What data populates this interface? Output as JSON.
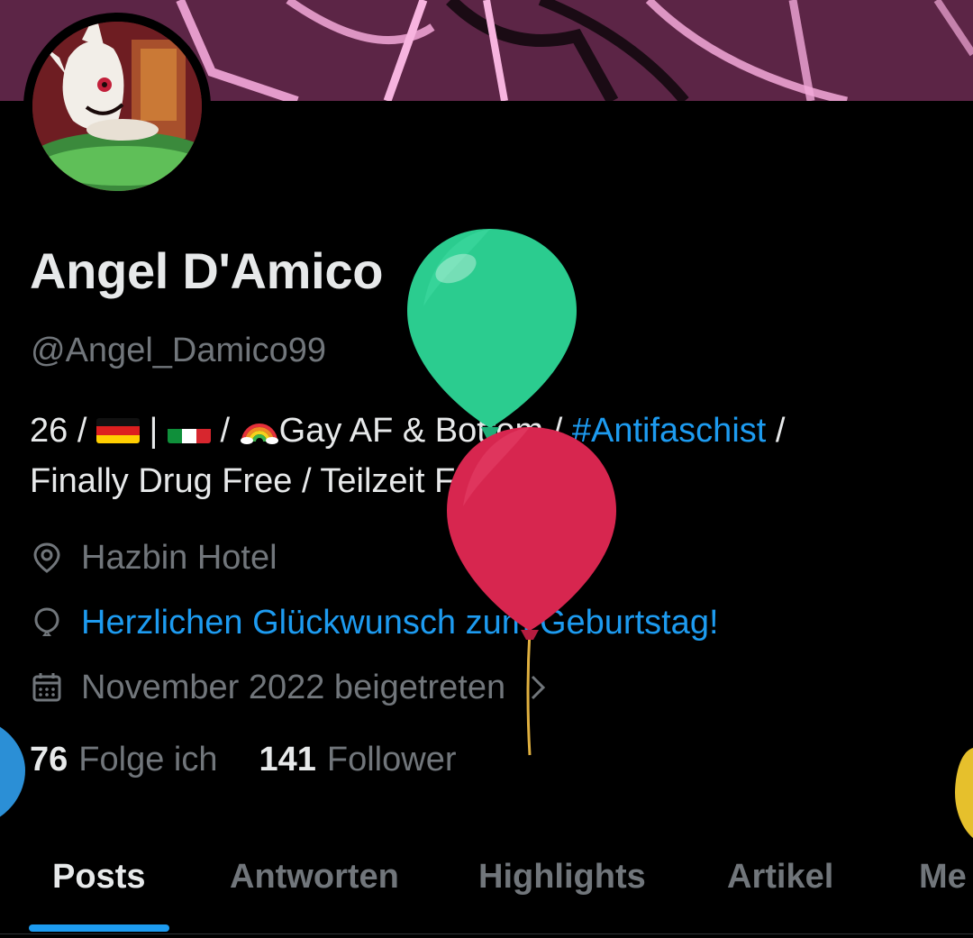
{
  "profile": {
    "display_name": "Angel D'Amico",
    "handle": "@Angel_Damico99",
    "bio": {
      "part1": "26 / ",
      "part2": " | ",
      "part3": " / ",
      "part4": "Gay AF & Bottom / ",
      "hashtag": "#Antifaschist",
      "part5": " /",
      "line2": "Finally Drug Free / Teilzeit Femboy"
    },
    "location": "Hazbin Hotel",
    "birthday": "Herzlichen Glückwunsch zum Geburtstag!",
    "joined": "November 2022 beigetreten"
  },
  "stats": {
    "following_count": "76",
    "following_label": "Folge ich",
    "followers_count": "141",
    "followers_label": "Follower"
  },
  "tabs": [
    "Posts",
    "Antworten",
    "Highlights",
    "Artikel",
    "Me"
  ],
  "active_tab": "Posts",
  "colors": {
    "accent": "#1d9bf0",
    "muted": "#71767b",
    "text": "#e7e9ea",
    "background": "#000000",
    "balloon_green": "#2bcc8f",
    "balloon_red": "#d7264f"
  },
  "icons": {
    "location": "location-pin-icon",
    "birthday": "balloon-icon",
    "joined": "calendar-icon",
    "joined_chevron": "chevron-right-icon",
    "flag_1": "germany-flag-icon",
    "flag_2": "italy-flag-icon",
    "rainbow": "rainbow-icon"
  }
}
